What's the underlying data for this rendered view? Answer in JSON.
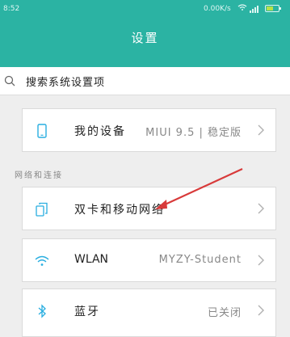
{
  "status_bar": {
    "time": "8:52",
    "network_speed": "0.00K/s",
    "battery_level": 0.55
  },
  "header": {
    "title": "设置"
  },
  "search": {
    "placeholder": "搜索系统设置项"
  },
  "items": [
    {
      "label": "我的设备",
      "value": "MIUI 9.5 | 稳定版",
      "icon": "phone-icon"
    },
    {
      "label": "双卡和移动网络",
      "value": "",
      "icon": "sim-card-icon"
    },
    {
      "label": "WLAN",
      "value": "MYZY-Student",
      "icon": "wifi-icon"
    },
    {
      "label": "蓝牙",
      "value": "已关闭",
      "icon": "bluetooth-icon"
    }
  ],
  "section": {
    "network_title": "网络和连接"
  },
  "colors": {
    "header": "#2bb3a3",
    "accent_icon": "#29aee0",
    "annotation_arrow": "#d83a3a"
  }
}
